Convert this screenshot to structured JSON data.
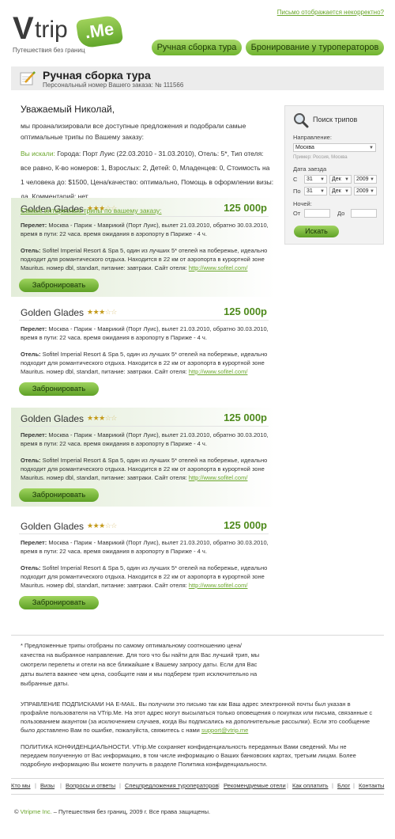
{
  "header": {
    "logo_v": "V",
    "logo_trip": "trip",
    "logo_me": ".Me",
    "tagline": "Путешествия без границ",
    "incorrect_link": "Письмо отображается некорректно?",
    "nav": [
      "Ручная сборка тура",
      "Бронирование у туроператоров"
    ]
  },
  "title_bar": {
    "title": "Ручная сборка тура",
    "order_number": "Персональный номер Вашего заказа: № 111566"
  },
  "intro": {
    "greeting": "Уважаемый Николай,",
    "text": "мы проанализировали все доступные предложения и подобрали самые оптимальные трипы по Вашему заказу:",
    "searched_label": "Вы искали:",
    "searched_text": " Города: Порт Луис (22.03.2010 - 31.03.2010), Отель: 5*, Тип отеля: все равно, К-во номеров: 1, Взрослых: 2, Детей: 0, Младенцев: 0, Стоимость на 1 человека до: $1500, Цена/качество: оптимально, Помощь в оформлении визы: да, Комментарий: нет",
    "favorites_link": "Самые интересные трипы по вашему заказу:"
  },
  "offers": [
    {
      "name": "Golden Glades",
      "stars_on": "★★★",
      "stars_off": "☆☆",
      "rating": 3,
      "price": "125 000р",
      "flight_label": "Перелет:",
      "flight": " Москва - Париж - Маврикий (Порт Луис), вылет 21.03.2010, обратно 30.03.2010, время в пути: 22 часа. время ожидания в аэропорту в Париже - 4 ч.",
      "hotel_label": "Отель:",
      "hotel": " Sofitel Imperial Resort & Spa 5, один из лучших  5* отелей на побережье, идеально подходит для романтического отдыха. Находится в 22 км от аэропорта в курортной зоне Mauritus. номер dbl, standart, питание: завтраки. Сайт отеля: ",
      "hotel_site": "http://www.sofitel.com/",
      "book": "Забронировать"
    },
    {
      "name": "Golden Glades",
      "stars_on": "★★★",
      "stars_off": "☆☆",
      "rating": 3,
      "price": "125 000р",
      "flight_label": "Перелет:",
      "flight": " Москва - Париж - Маврикий (Порт Луис), вылет 21.03.2010, обратно 30.03.2010, время в пути: 22 часа. время ожидания в аэропорту в Париже - 4 ч.",
      "hotel_label": "Отель:",
      "hotel": " Sofitel Imperial Resort & Spa 5, один из лучших  5* отелей на побережье, идеально подходит для романтического отдыха. Находится в 22 км от аэропорта в курортной зоне Mauritus. номер dbl, standart, питание: завтраки. Сайт отеля: ",
      "hotel_site": "http://www.sofitel.com/",
      "book": "Забронировать"
    },
    {
      "name": "Golden Glades",
      "stars_on": "★★★",
      "stars_off": "☆☆",
      "rating": 3,
      "price": "125 000р",
      "flight_label": "Перелет:",
      "flight": " Москва - Париж - Маврикий (Порт Луис), вылет 21.03.2010, обратно 30.03.2010, время в пути: 22 часа. время ожидания в аэропорту в Париже - 4 ч.",
      "hotel_label": "Отель:",
      "hotel": " Sofitel Imperial Resort & Spa 5, один из лучших  5* отелей на побережье, идеально подходит для романтического отдыха. Находится в 22 км от аэропорта в курортной зоне Mauritus. номер dbl, standart, питание: завтраки. Сайт отеля: ",
      "hotel_site": "http://www.sofitel.com/",
      "book": "Забронировать"
    },
    {
      "name": "Golden Glades",
      "stars_on": "★★★",
      "stars_off": "☆☆",
      "rating": 3,
      "price": "125 000р",
      "flight_label": "Перелет:",
      "flight": " Москва - Париж - Маврикий (Порт Луис), вылет 21.03.2010, обратно 30.03.2010, время в пути: 22 часа. время ожидания в аэропорту в Париже - 4 ч.",
      "hotel_label": "Отель:",
      "hotel": " Sofitel Imperial Resort & Spa 5, один из лучших  5* отелей на побережье, идеально подходит для романтического отдыха. Находится в 22 км от аэропорта в курортной зоне Mauritus. номер dbl, standart, питание: завтраки. Сайт отеля: ",
      "hotel_site": "http://www.sofitel.com/",
      "book": "Забронировать"
    }
  ],
  "search_panel": {
    "title": "Поиск трипов",
    "direction_label": "Направление:",
    "direction_value": "Москва",
    "direction_hint": "Пример: Россия, Москва",
    "date_label": "Дата заезда",
    "from_label": "С",
    "to_label": "По",
    "from_day": "31",
    "from_month": "Дек",
    "from_year": "2009",
    "to_day": "31",
    "to_month": "Дек",
    "to_year": "2009",
    "nights_label": "Ночей:",
    "nights_from_label": "От",
    "nights_to_label": "До",
    "search_button": "Искать"
  },
  "footer": {
    "note": "* Предложенные трипы отобраны по самому оптимальному соотношению цена/качества на выбранное направление. Для того что бы найти для Вас лучший трип, мы смотрели перелеты и отели на все ближайшие к Вашему запросу даты. Если для Вас даты вылета важнее чем цена, сообщите нам и мы подберем трип исключительно на выбранные даты.",
    "management": "УПРАВЛЕНИЕ ПОДПИСКАМИ НА E-MAIL. Вы получили это письмо так как Ваш адрес электронной почты был указан в профайле пользователя на VTrip.Me. На этот адрес могут высылаться только оповещения о покупках или письма, связанные с пользованием акаунтом (за исключением случаев, когда Вы подписались на дополнительные рассылки). Если это сообщение было доставлено Вам по ошибке, пожалуйста, свяжитесь с нами ",
    "support_email": "support@vtrip.me",
    "privacy": "ПОЛИТИКА КОНФИДЕНЦИАЛЬНОСТИ. VTrip.Me сохраняет конфиденциальность переданных Вами сведений. Мы не передаем полученную от Вас информацию, в том числе информацию о Ваших банковских картах, третьим лицам. Более подробную информацию Вы можете получить в разделе Политика конфиденциальности.",
    "links": [
      "Кто мы",
      "Визы",
      "Вопросы и ответы",
      "Спецпредложения туроператоров",
      "Рекомендуемые отели",
      "Как оплатить",
      "Блог",
      "Контакты"
    ],
    "copyright_prefix": "© ",
    "copyright_company": "Vtripme Inc.",
    "copyright_rest": " – Путешествия без границ, 2009 г. Все права защищены."
  },
  "colors": {
    "accent": "#6aa62b",
    "button_green": "#7dbf3a",
    "price": "#4e8a1c",
    "panel_bg": "#f2f2f2",
    "title_bar_bg": "#ececec"
  }
}
